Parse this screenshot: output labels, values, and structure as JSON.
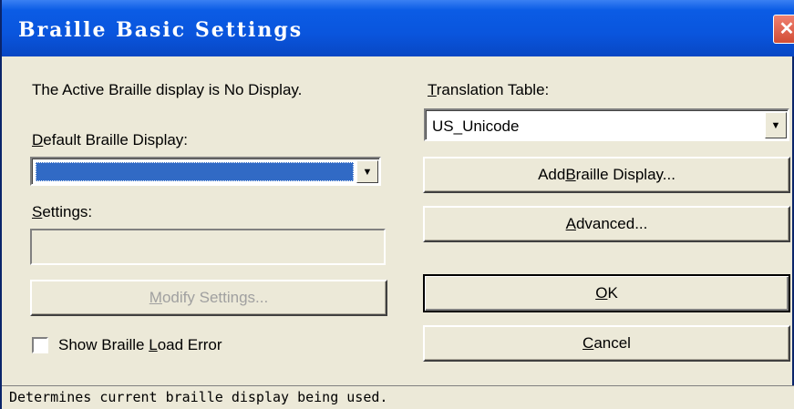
{
  "window": {
    "title": "Braille Basic Settings",
    "close_glyph": "✕"
  },
  "left": {
    "active_display_text": "The Active Braille display is No Display.",
    "default_display_label": {
      "pre": "",
      "key": "D",
      "post": "efault Braille Display:"
    },
    "default_display_value": "",
    "settings_label": {
      "pre": "",
      "key": "S",
      "post": "ettings:"
    },
    "settings_value": "",
    "modify_button": {
      "pre": "",
      "key": "M",
      "post": "odify Settings..."
    },
    "show_error_checkbox": {
      "pre": "Show Braille ",
      "key": "L",
      "post": "oad Error",
      "checked": false
    }
  },
  "right": {
    "translation_label": {
      "pre": "",
      "key": "T",
      "post": "ranslation Table:"
    },
    "translation_value": "US_Unicode",
    "add_button": {
      "pre": "Add ",
      "key": "B",
      "post": "raille Display..."
    },
    "advanced_button": {
      "pre": "",
      "key": "A",
      "post": "dvanced..."
    },
    "ok_button": {
      "pre": "",
      "key": "O",
      "post": "K"
    },
    "cancel_button": {
      "pre": "",
      "key": "C",
      "post": "ancel"
    }
  },
  "status_bar": {
    "text": "Determines current braille display being used."
  },
  "colors": {
    "title_bar": "#0a55dd",
    "dialog_bg": "#ece9d8",
    "selection": "#316ac5",
    "close_button": "#d24d35"
  },
  "icons": {
    "dropdown": "triangle-down",
    "close": "x"
  }
}
